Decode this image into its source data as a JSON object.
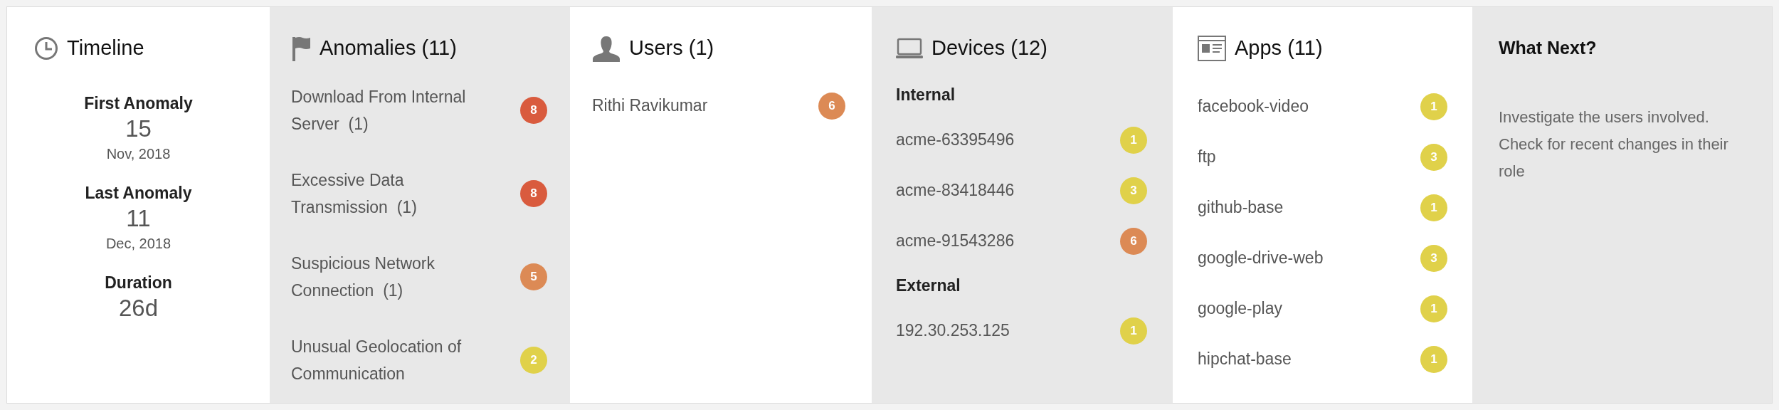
{
  "timeline": {
    "title": "Timeline",
    "entries": [
      {
        "label": "First Anomaly",
        "value": "15",
        "sub": "Nov, 2018"
      },
      {
        "label": "Last Anomaly",
        "value": "11",
        "sub": "Dec, 2018"
      },
      {
        "label": "Duration",
        "value": "26d"
      }
    ]
  },
  "anomalies": {
    "title": "Anomalies",
    "count": "(11)",
    "items": [
      {
        "name": "Download From Internal Server",
        "count": "(1)",
        "score": "8",
        "color": "#d95b3e"
      },
      {
        "name": "Excessive Data Transmission",
        "count": "(1)",
        "score": "8",
        "color": "#d95b3e"
      },
      {
        "name": "Suspicious Network Connection",
        "count": "(1)",
        "score": "5",
        "color": "#dc8a55"
      },
      {
        "name": "Unusual Geolocation of Communication",
        "score": "2",
        "color": "#e0d14a"
      }
    ]
  },
  "users": {
    "title": "Users",
    "count": "(1)",
    "items": [
      {
        "name": "Rithi Ravikumar",
        "score": "6",
        "color": "#dc8a55"
      }
    ]
  },
  "devices": {
    "title": "Devices",
    "count": "(12)",
    "groups": [
      {
        "label": "Internal",
        "items": [
          {
            "name": "acme-63395496",
            "score": "1",
            "color": "#e0d14a"
          },
          {
            "name": "acme-83418446",
            "score": "3",
            "color": "#e0d14a"
          },
          {
            "name": "acme-91543286",
            "score": "6",
            "color": "#dc8a55"
          }
        ]
      },
      {
        "label": "External",
        "items": [
          {
            "name": "192.30.253.125",
            "score": "1",
            "color": "#e0d14a"
          }
        ]
      }
    ]
  },
  "apps": {
    "title": "Apps",
    "count": "(11)",
    "items": [
      {
        "name": "facebook-video",
        "score": "1",
        "color": "#e0d14a"
      },
      {
        "name": "ftp",
        "score": "3",
        "color": "#e0d14a"
      },
      {
        "name": "github-base",
        "score": "1",
        "color": "#e0d14a"
      },
      {
        "name": "google-drive-web",
        "score": "3",
        "color": "#e0d14a"
      },
      {
        "name": "google-play",
        "score": "1",
        "color": "#e0d14a"
      },
      {
        "name": "hipchat-base",
        "score": "1",
        "color": "#e0d14a"
      }
    ]
  },
  "what_next": {
    "title": "What Next?",
    "text": "Investigate the users involved. Check for recent changes in their role"
  }
}
